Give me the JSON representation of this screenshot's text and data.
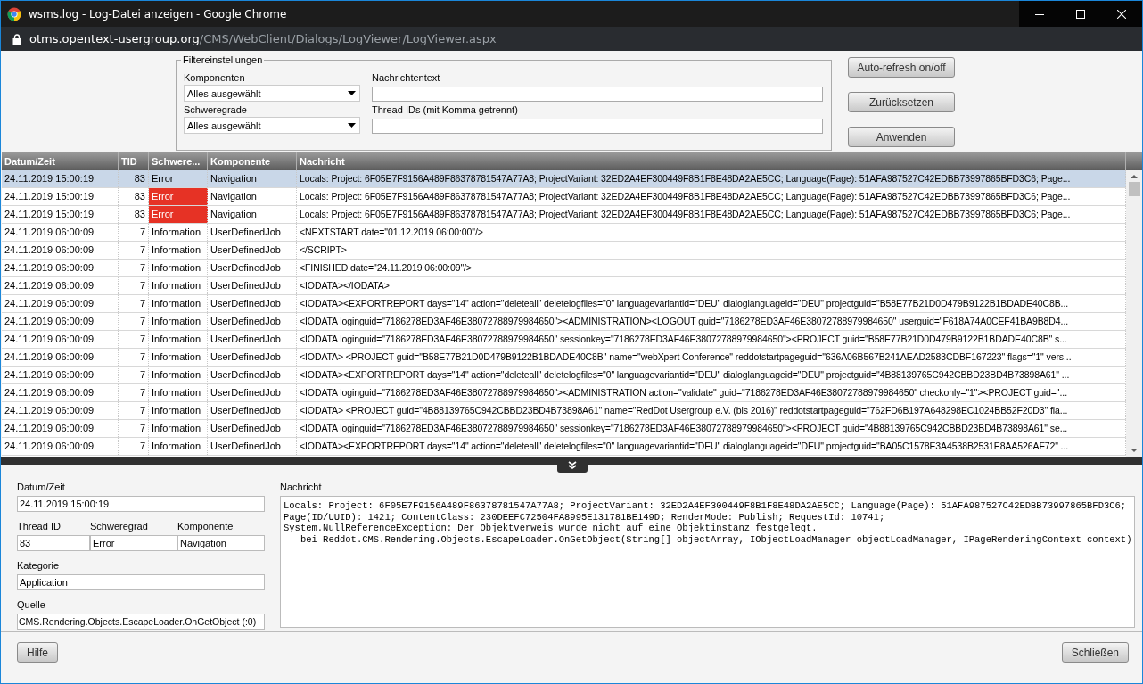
{
  "window": {
    "title": "wsms.log - Log-Datei anzeigen - Google Chrome"
  },
  "address_bar": {
    "host": "otms.opentext-usergroup.org",
    "path": "/CMS/WebClient/Dialogs/LogViewer/LogViewer.aspx"
  },
  "filter": {
    "legend": "Filtereinstellungen",
    "components": {
      "label": "Komponenten",
      "value": "Alles ausgewählt"
    },
    "severities": {
      "label": "Schweregrade",
      "value": "Alles ausgewählt"
    },
    "message_text": {
      "label": "Nachrichtentext"
    },
    "thread_ids": {
      "label": "Thread IDs (mit Komma getrennt)"
    }
  },
  "buttons": [
    "Auto-refresh on/off",
    "Zurücksetzen",
    "Anwenden"
  ],
  "table": {
    "columns": [
      "Datum/Zeit",
      "TID",
      "Schwere...",
      "Komponente",
      "Nachricht"
    ],
    "rows": [
      {
        "datetime": "24.11.2019 15:00:19",
        "tid": "83",
        "severity": "Error",
        "component": "Navigation",
        "message": "Locals: Project: 6F05E7F9156A489F86378781547A77A8; ProjectVariant: 32ED2A4EF300449F8B1F8E48DA2AE5CC; Language(Page): 51AFA987527C42EDBB73997865BFD3C6; Page...",
        "selected": true
      },
      {
        "datetime": "24.11.2019 15:00:19",
        "tid": "83",
        "severity": "Error",
        "component": "Navigation",
        "message": "Locals: Project: 6F05E7F9156A489F86378781547A77A8; ProjectVariant: 32ED2A4EF300449F8B1F8E48DA2AE5CC; Language(Page): 51AFA987527C42EDBB73997865BFD3C6; Page...",
        "selected": false,
        "color": "#e63225"
      },
      {
        "datetime": "24.11.2019 15:00:19",
        "tid": "83",
        "severity": "Error",
        "component": "Navigation",
        "message": "Locals: Project: 6F05E7F9156A489F86378781547A77A8; ProjectVariant: 32ED2A4EF300449F8B1F8E48DA2AE5CC; Language(Page): 51AFA987527C42EDBB73997865BFD3C6; Page...",
        "selected": false,
        "color": "#e63225"
      },
      {
        "datetime": "24.11.2019 06:00:09",
        "tid": "7",
        "severity": "Information",
        "component": "UserDefinedJob",
        "message": "<NEXTSTART date=\"01.12.2019 06:00:00\"/>",
        "selected": false
      },
      {
        "datetime": "24.11.2019 06:00:09",
        "tid": "7",
        "severity": "Information",
        "component": "UserDefinedJob",
        "message": "</SCRIPT>",
        "selected": false
      },
      {
        "datetime": "24.11.2019 06:00:09",
        "tid": "7",
        "severity": "Information",
        "component": "UserDefinedJob",
        "message": "<FINISHED date=\"24.11.2019 06:00:09\"/>",
        "selected": false
      },
      {
        "datetime": "24.11.2019 06:00:09",
        "tid": "7",
        "severity": "Information",
        "component": "UserDefinedJob",
        "message": "<IODATA></IODATA>",
        "selected": false
      },
      {
        "datetime": "24.11.2019 06:00:09",
        "tid": "7",
        "severity": "Information",
        "component": "UserDefinedJob",
        "message": "<IODATA><EXPORTREPORT days=\"14\" action=\"deleteall\" deletelogfiles=\"0\" languagevariantid=\"DEU\" dialoglanguageid=\"DEU\" projectguid=\"B58E77B21D0D479B9122B1BDADE40C8B...",
        "selected": false
      },
      {
        "datetime": "24.11.2019 06:00:09",
        "tid": "7",
        "severity": "Information",
        "component": "UserDefinedJob",
        "message": "<IODATA loginguid=\"7186278ED3AF46E38072788979984650\"><ADMINISTRATION><LOGOUT guid=\"7186278ED3AF46E38072788979984650\" userguid=\"F618A74A0CEF41BA9B8D4...",
        "selected": false
      },
      {
        "datetime": "24.11.2019 06:00:09",
        "tid": "7",
        "severity": "Information",
        "component": "UserDefinedJob",
        "message": "<IODATA loginguid=\"7186278ED3AF46E38072788979984650\" sessionkey=\"7186278ED3AF46E38072788979984650\"><PROJECT guid=\"B58E77B21D0D479B9122B1BDADE40C8B\" s...",
        "selected": false
      },
      {
        "datetime": "24.11.2019 06:00:09",
        "tid": "7",
        "severity": "Information",
        "component": "UserDefinedJob",
        "message": "<IODATA> <PROJECT guid=\"B58E77B21D0D479B9122B1BDADE40C8B\" name=\"webXpert Conference\" reddotstartpageguid=\"636A06B567B241AEAD2583CDBF167223\" flags=\"1\" vers...",
        "selected": false
      },
      {
        "datetime": "24.11.2019 06:00:09",
        "tid": "7",
        "severity": "Information",
        "component": "UserDefinedJob",
        "message": "<IODATA><EXPORTREPORT days=\"14\" action=\"deleteall\" deletelogfiles=\"0\" languagevariantid=\"DEU\" dialoglanguageid=\"DEU\" projectguid=\"4B88139765C942CBBD23BD4B73898A61\" ...",
        "selected": false
      },
      {
        "datetime": "24.11.2019 06:00:09",
        "tid": "7",
        "severity": "Information",
        "component": "UserDefinedJob",
        "message": "<IODATA loginguid=\"7186278ED3AF46E38072788979984650\"><ADMINISTRATION action=\"validate\" guid=\"7186278ED3AF46E38072788979984650\" checkonly=\"1\"><PROJECT guid=\"...",
        "selected": false
      },
      {
        "datetime": "24.11.2019 06:00:09",
        "tid": "7",
        "severity": "Information",
        "component": "UserDefinedJob",
        "message": "<IODATA> <PROJECT guid=\"4B88139765C942CBBD23BD4B73898A61\" name=\"RedDot Usergroup e.V. (bis 2016)\" reddotstartpageguid=\"762FD6B197A648298EC1024BB52F20D3\" fla...",
        "selected": false
      },
      {
        "datetime": "24.11.2019 06:00:09",
        "tid": "7",
        "severity": "Information",
        "component": "UserDefinedJob",
        "message": "<IODATA loginguid=\"7186278ED3AF46E38072788979984650\" sessionkey=\"7186278ED3AF46E38072788979984650\"><PROJECT guid=\"4B88139765C942CBBD23BD4B73898A61\" se...",
        "selected": false
      },
      {
        "datetime": "24.11.2019 06:00:09",
        "tid": "7",
        "severity": "Information",
        "component": "UserDefinedJob",
        "message": "<IODATA><EXPORTREPORT days=\"14\" action=\"deleteall\" deletelogfiles=\"0\" languagevariantid=\"DEU\" dialoglanguageid=\"DEU\" projectguid=\"BA05C1578E3A4538B2531E8AA526AF72\" ...",
        "selected": false
      }
    ]
  },
  "details": {
    "datetime": {
      "label": "Datum/Zeit",
      "value": "24.11.2019 15:00:19"
    },
    "thread_id": {
      "label": "Thread ID",
      "value": "83"
    },
    "severity": {
      "label": "Schweregrad",
      "value": "Error"
    },
    "component": {
      "label": "Komponente",
      "value": "Navigation"
    },
    "category": {
      "label": "Kategorie",
      "value": "Application"
    },
    "source": {
      "label": "Quelle",
      "value": "CMS.Rendering.Objects.EscapeLoader.OnGetObject (:0)"
    },
    "message": {
      "label": "Nachricht",
      "value": "Locals: Project: 6F05E7F9156A489F86378781547A77A8; ProjectVariant: 32ED2A4EF300449F8B1F8E48DA2AE5CC; Language(Page): 51AFA987527C42EDBB73997865BFD3C6;\nPage(ID/UUID): 1421; ContentClass: 230DEEFC72504FA8995E131781BE149D; RenderMode: Publish; RequestId: 10741;\nSystem.NullReferenceException: Der Objektverweis wurde nicht auf eine Objektinstanz festgelegt.\n   bei Reddot.CMS.Rendering.Objects.EscapeLoader.OnGetObject(String[] objectArray, IObjectLoadManager objectLoadManager, IPageRenderingContext context)"
    }
  },
  "footer_buttons": [
    "Hilfe",
    "Schließen"
  ]
}
